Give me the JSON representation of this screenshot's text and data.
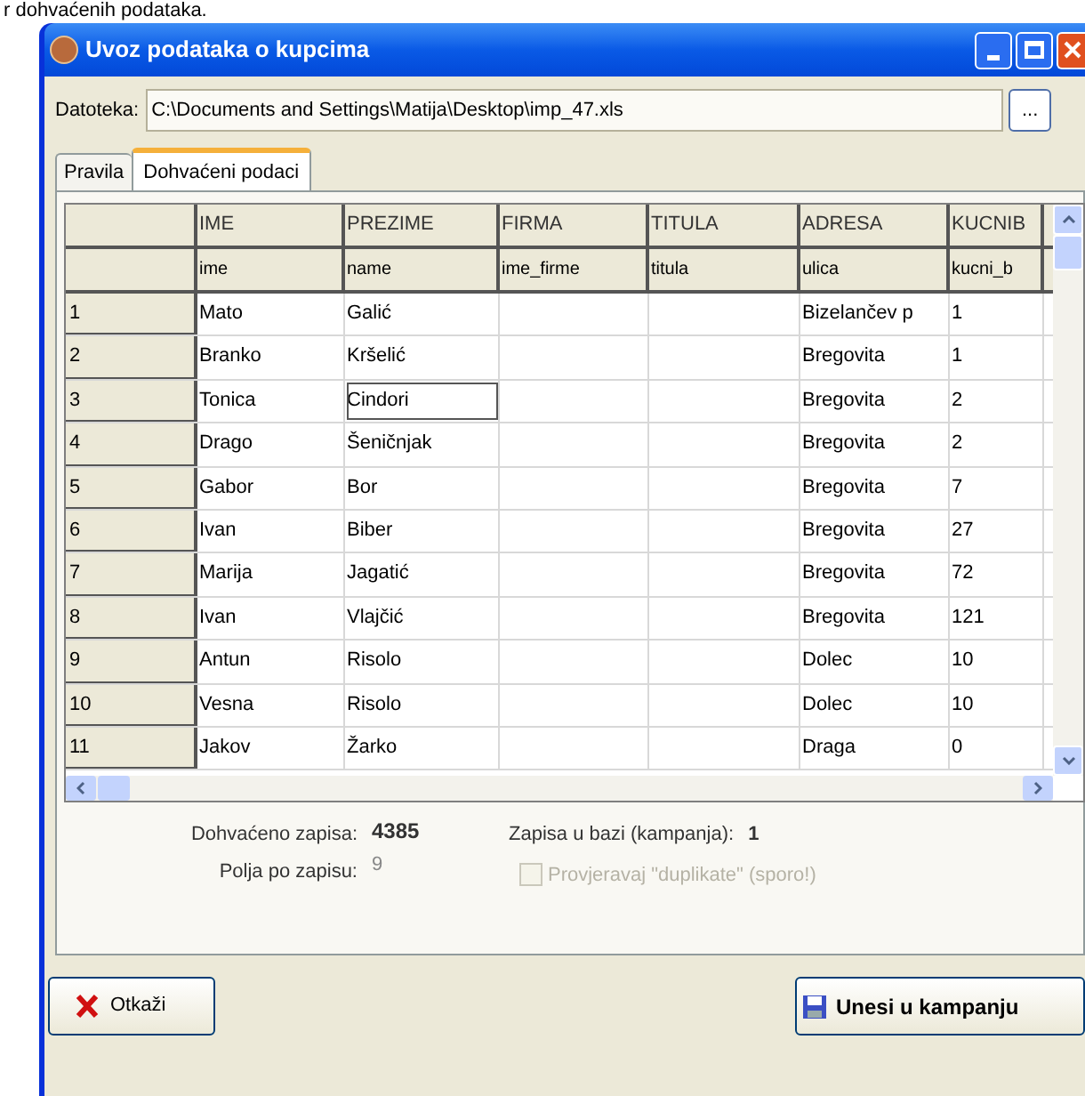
{
  "caption": "r dohvaćenih podataka.",
  "window": {
    "title": "Uvoz podataka o kupcima"
  },
  "file": {
    "label": "Datoteka:",
    "value": "C:\\Documents and Settings\\Matija\\Desktop\\imp_47.xls",
    "browse": "..."
  },
  "tabs": [
    {
      "label": "Pravila",
      "selected": false
    },
    {
      "label": "Dohvaćeni podaci",
      "selected": true
    }
  ],
  "table": {
    "columns": [
      {
        "heading": "IME",
        "field": "ime"
      },
      {
        "heading": "PREZIME",
        "field": "name"
      },
      {
        "heading": "FIRMA",
        "field": "ime_firme"
      },
      {
        "heading": "TITULA",
        "field": "titula"
      },
      {
        "heading": "ADRESA",
        "field": "ulica"
      },
      {
        "heading": "KUCNIB",
        "field": "kucni_b"
      }
    ],
    "rows": [
      {
        "number": "1",
        "cells": [
          {
            "text": "Mato",
            "focused": false
          },
          {
            "text": "Galić",
            "focused": false
          },
          {
            "focused": false
          },
          {
            "focused": false
          },
          {
            "text": "Bizelančev p",
            "focused": false
          },
          {
            "text": "1",
            "focused": false
          }
        ]
      },
      {
        "number": "2",
        "cells": [
          {
            "text": "Branko",
            "focused": false
          },
          {
            "text": "Kršelić",
            "focused": false
          },
          {
            "focused": false
          },
          {
            "focused": false
          },
          {
            "text": "Bregovita",
            "focused": false
          },
          {
            "text": "1",
            "focused": false
          }
        ]
      },
      {
        "number": "3",
        "cells": [
          {
            "text": "Tonica",
            "focused": false
          },
          {
            "text": "Cindori",
            "focused": true
          },
          {
            "focused": false
          },
          {
            "focused": false
          },
          {
            "text": "Bregovita",
            "focused": false
          },
          {
            "text": "2",
            "focused": false
          }
        ]
      },
      {
        "number": "4",
        "cells": [
          {
            "text": "Drago",
            "focused": false
          },
          {
            "text": "Šeničnjak",
            "focused": false
          },
          {
            "focused": false
          },
          {
            "focused": false
          },
          {
            "text": "Bregovita",
            "focused": false
          },
          {
            "text": "2",
            "focused": false
          }
        ]
      },
      {
        "number": "5",
        "cells": [
          {
            "text": "Gabor",
            "focused": false
          },
          {
            "text": "Bor",
            "focused": false
          },
          {
            "focused": false
          },
          {
            "focused": false
          },
          {
            "text": "Bregovita",
            "focused": false
          },
          {
            "text": "7",
            "focused": false
          }
        ]
      },
      {
        "number": "6",
        "cells": [
          {
            "text": "Ivan",
            "focused": false
          },
          {
            "text": "Biber",
            "focused": false
          },
          {
            "focused": false
          },
          {
            "focused": false
          },
          {
            "text": "Bregovita",
            "focused": false
          },
          {
            "text": "27",
            "focused": false
          }
        ]
      },
      {
        "number": "7",
        "cells": [
          {
            "text": "Marija",
            "focused": false
          },
          {
            "text": "Jagatić",
            "focused": false
          },
          {
            "focused": false
          },
          {
            "focused": false
          },
          {
            "text": "Bregovita",
            "focused": false
          },
          {
            "text": "72",
            "focused": false
          }
        ]
      },
      {
        "number": "8",
        "cells": [
          {
            "text": "Ivan",
            "focused": false
          },
          {
            "text": "Vlajčić",
            "focused": false
          },
          {
            "focused": false
          },
          {
            "focused": false
          },
          {
            "text": "Bregovita",
            "focused": false
          },
          {
            "text": "121",
            "focused": false
          }
        ]
      },
      {
        "number": "9",
        "cells": [
          {
            "text": "Antun",
            "focused": false
          },
          {
            "text": "Risolo",
            "focused": false
          },
          {
            "focused": false
          },
          {
            "focused": false
          },
          {
            "text": "Dolec",
            "focused": false
          },
          {
            "text": "10",
            "focused": false
          }
        ]
      },
      {
        "number": "10",
        "cells": [
          {
            "text": "Vesna",
            "focused": false
          },
          {
            "text": "Risolo",
            "focused": false
          },
          {
            "focused": false
          },
          {
            "focused": false
          },
          {
            "text": "Dolec",
            "focused": false
          },
          {
            "text": "10",
            "focused": false
          }
        ]
      },
      {
        "number": "11",
        "cells": [
          {
            "text": "Jakov",
            "focused": false
          },
          {
            "text": "Žarko",
            "focused": false
          },
          {
            "focused": false
          },
          {
            "focused": false
          },
          {
            "text": "Draga",
            "focused": false
          },
          {
            "text": "0",
            "focused": false
          }
        ]
      }
    ]
  },
  "stats": {
    "fetched_label": "Dohvaćeno zapisa:",
    "fetched_value": "4385",
    "fields_label": "Polja po zapisu:",
    "fields_value": "9",
    "db_label": "Zapisa u bazi (kampanja):",
    "db_value": "1"
  },
  "duplicates_check": {
    "label": "Provjeravaj \"duplikate\" (sporo!)",
    "checked": false,
    "disabled": true
  },
  "buttons": {
    "cancel": "Otkaži",
    "submit": "Unesi u kampanju"
  }
}
